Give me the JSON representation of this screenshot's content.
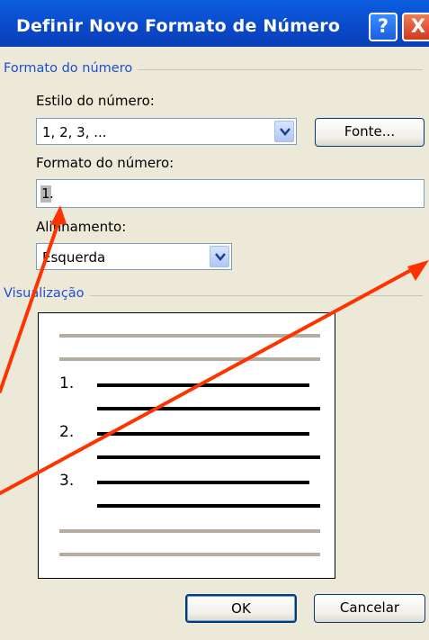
{
  "dialog": {
    "title": "Definir Novo Formato de Número",
    "help_glyph": "?",
    "close_glyph": "X"
  },
  "number_format_group": {
    "legend": "Formato do número",
    "style_label": "Estilo do número:",
    "style_value": "1, 2, 3, ...",
    "font_button": "Fonte...",
    "format_label": "Formato do número:",
    "format_value_selected": "1",
    "format_value_rest": ".",
    "alignment_label": "Alinhamento:",
    "alignment_value": "Esquerda"
  },
  "preview_group": {
    "legend": "Visualização",
    "numbers": [
      "1.",
      "2.",
      "3."
    ]
  },
  "footer": {
    "ok_label": "OK",
    "cancel_label": "Cancelar"
  },
  "colors": {
    "titlebar": "#0a48c8",
    "annotation_arrow": "#ff3300",
    "preview_gray_line": "#b3ae9f"
  }
}
